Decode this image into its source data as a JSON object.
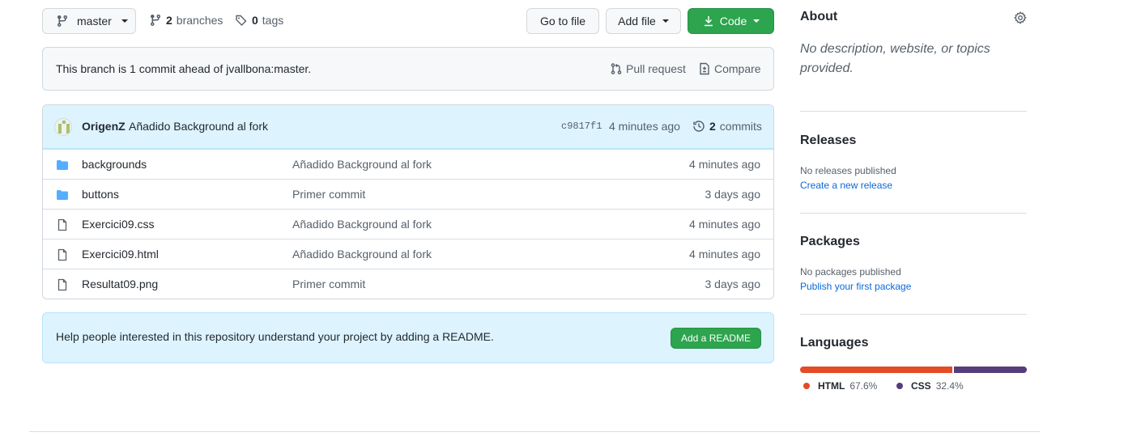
{
  "toolbar": {
    "branch": "master",
    "branches_count": "2",
    "branches_label": "branches",
    "tags_count": "0",
    "tags_label": "tags",
    "go_to_file": "Go to file",
    "add_file": "Add file",
    "code": "Code"
  },
  "ahead": {
    "text": "This branch is 1 commit ahead of jvallbona:master.",
    "pull_request": "Pull request",
    "compare": "Compare"
  },
  "latest_commit": {
    "author": "OrigenZ",
    "message": "Añadido Background al fork",
    "sha": "c9817f1",
    "time": "4 minutes ago",
    "commits_count": "2",
    "commits_label": "commits"
  },
  "files": [
    {
      "type": "folder",
      "name": "backgrounds",
      "message": "Añadido Background al fork",
      "time": "4 minutes ago"
    },
    {
      "type": "folder",
      "name": "buttons",
      "message": "Primer commit",
      "time": "3 days ago"
    },
    {
      "type": "file",
      "name": "Exercici09.css",
      "message": "Añadido Background al fork",
      "time": "4 minutes ago"
    },
    {
      "type": "file",
      "name": "Exercici09.html",
      "message": "Añadido Background al fork",
      "time": "4 minutes ago"
    },
    {
      "type": "file",
      "name": "Resultat09.png",
      "message": "Primer commit",
      "time": "3 days ago"
    }
  ],
  "readme": {
    "text": "Help people interested in this repository understand your project by adding a README.",
    "button": "Add a README"
  },
  "sidebar": {
    "about_title": "About",
    "about_desc": "No description, website, or topics provided.",
    "releases_title": "Releases",
    "releases_empty": "No releases published",
    "releases_link": "Create a new release",
    "packages_title": "Packages",
    "packages_empty": "No packages published",
    "packages_link": "Publish your first package",
    "languages_title": "Languages",
    "languages": [
      {
        "name": "HTML",
        "percent": "67.6%",
        "value": 67.6,
        "color": "#e34c26"
      },
      {
        "name": "CSS",
        "percent": "32.4%",
        "value": 32.4,
        "color": "#563d7c"
      }
    ]
  },
  "colors": {
    "accent_green": "#2da44e",
    "link_blue": "#0969da",
    "folder_blue": "#54aeff"
  }
}
